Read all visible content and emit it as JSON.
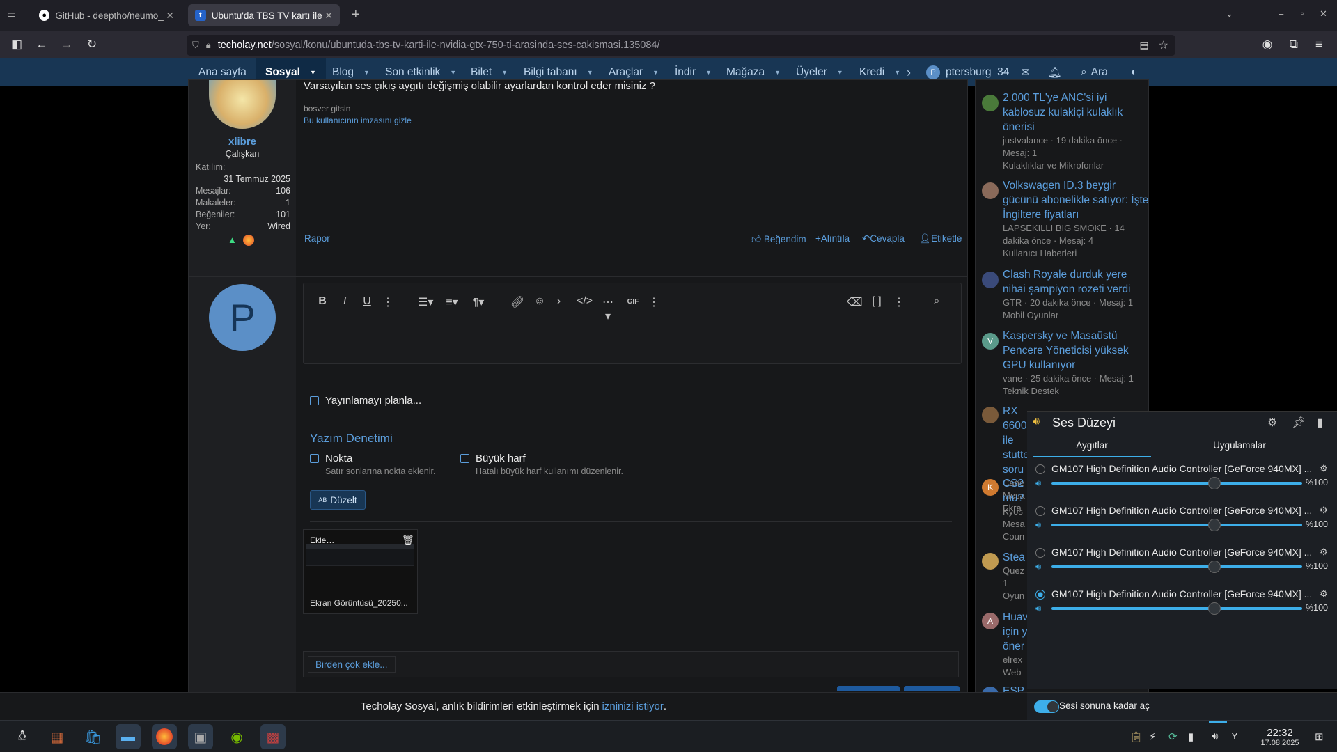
{
  "tabs": [
    {
      "title": "GitHub - deeptho/neumo_",
      "icon": "github-icon"
    },
    {
      "title": "Ubuntu'da TBS TV kartı ile",
      "icon": "techolay-icon"
    }
  ],
  "url": {
    "host": "techolay.net",
    "path": "/sosyal/konu/ubuntuda-tbs-tv-karti-ile-nvidia-gtx-750-ti-arasinda-ses-cakismasi.135084/"
  },
  "site_nav": {
    "items": [
      "Ana sayfa",
      "Sosyal",
      "Blog",
      "Son etkinlik",
      "Bilet",
      "Bilgi tabanı",
      "Araçlar",
      "İndir",
      "Mağaza",
      "Üyeler",
      "Kredi"
    ],
    "user": "ptersburg_34",
    "user_initial": "P",
    "search": "Ara"
  },
  "post": {
    "text": "Varsayılan ses çıkış aygıtı değişmiş olabilir ayarlardan kontrol eder misiniz ?",
    "signature": "bosver gitsin",
    "hide_signature": "Bu kullanıcının imzasını gizle",
    "report": "Rapor",
    "actions": {
      "like": "Beğendim",
      "quote": "Alıntıla",
      "reply": "Cevapla",
      "tag": "Etiketle"
    },
    "author": {
      "name": "xlibre",
      "title": "Çalışkan",
      "joined_label": "Katılım:",
      "joined": "31 Temmuz 2025",
      "stats": [
        {
          "label": "Mesajlar:",
          "value": "106"
        },
        {
          "label": "Makaleler:",
          "value": "1"
        },
        {
          "label": "Beğeniler:",
          "value": "101"
        },
        {
          "label": "Yer:",
          "value": "Wired"
        }
      ]
    }
  },
  "editor": {
    "avatar_initial": "P",
    "schedule": "Yayınlamayı planla...",
    "spellcheck_title": "Yazım Denetimi",
    "opt1_title": "Nokta",
    "opt1_desc": "Satır sonlarına nokta eklenir.",
    "opt2_title": "Büyük harf",
    "opt2_desc": "Hatalı büyük harf kullanımı düzenlenir.",
    "fix_button": "Düzelt",
    "attachment_add": "Ekle…",
    "attachment_name": "Ekran Görüntüsü_20250...",
    "multi_add": "Birden çok ekle..."
  },
  "feed": [
    {
      "title": "2.000 TL'ye ANC'si iyi kablosuz kulakiçi kulaklık önerisi",
      "meta": "justvalance · 19 dakika önce · Mesaj: 1",
      "forum": "Kulaklıklar ve Mikrofonlar",
      "avatar_color": "#4a7a3a"
    },
    {
      "title": "Volkswagen ID.3 beygir gücünü abonelikle satıyor: İşte İngiltere fiyatları",
      "meta": "LAPSEKILLI BIG SMOKE · 14 dakika önce · Mesaj: 4",
      "forum": "Kullanıcı Haberleri",
      "avatar_color": "#8a6a5a"
    },
    {
      "title": "Clash Royale durduk yere nihai şampiyon rozeti verdi",
      "meta": "GTR · 20 dakika önce · Mesaj: 1",
      "forum": "Mobil Oyunlar",
      "avatar_color": "#3a4a7a"
    },
    {
      "title": "Kaspersky ve Masaüstü Pencere Yöneticisi yüksek GPU kullanıyor",
      "meta": "vane · 25 dakika önce · Mesaj: 1",
      "forum": "Teknik Destek",
      "avatar_color": "#5a9a8a",
      "initial": "V"
    }
  ],
  "feed_partial": [
    {
      "title": "RX 6600 ile stuttering soru",
      "lines": [
        "Cane",
        "Mesa",
        "Ekra"
      ],
      "avatar_color": "#7a5a3a"
    },
    {
      "title": "CS2 mu?",
      "lines": [
        "Kyos",
        "Mesa",
        "Coun"
      ],
      "avatar_color": "#d07a30",
      "initial": "K"
    },
    {
      "title": "Stea",
      "lines": [
        "Quez",
        "1",
        "Oyun"
      ],
      "avatar_color": "#c09a50"
    },
    {
      "title": "Huav için y öner",
      "lines": [
        "elrex",
        "Web"
      ],
      "avatar_color": "#9a6a6a",
      "initial": "A"
    },
    {
      "title": "ESP",
      "lines": [],
      "avatar_color": "#3a6aaa"
    }
  ],
  "volume": {
    "title": "Ses Düzeyi",
    "tabs": [
      "Aygıtlar",
      "Uygulamalar"
    ],
    "devices": [
      {
        "name": "GM107 High Definition Audio Controller [GeForce 940MX] ...",
        "level": 1.0,
        "label": "%100",
        "selected": false
      },
      {
        "name": "GM107 High Definition Audio Controller [GeForce 940MX] ...",
        "level": 1.0,
        "label": "%100",
        "selected": false
      },
      {
        "name": "GM107 High Definition Audio Controller [GeForce 940MX] ...",
        "level": 1.0,
        "label": "%100",
        "selected": false
      },
      {
        "name": "GM107 High Definition Audio Controller [GeForce 940MX] ...",
        "level": 1.0,
        "label": "%100",
        "selected": true
      }
    ],
    "raise_max": "Sesi sonuna kadar aç"
  },
  "notification": {
    "text": "Techolay Sosyal, anlık bildirimleri etkinleştirmek için ",
    "link": "izninizi istiyor",
    "end": "."
  },
  "clock": {
    "time": "22:32",
    "date": "17.08.2025"
  },
  "colors": {
    "accent": "#3daee9",
    "link": "#5b9ddb",
    "site_nav": "#183654"
  }
}
